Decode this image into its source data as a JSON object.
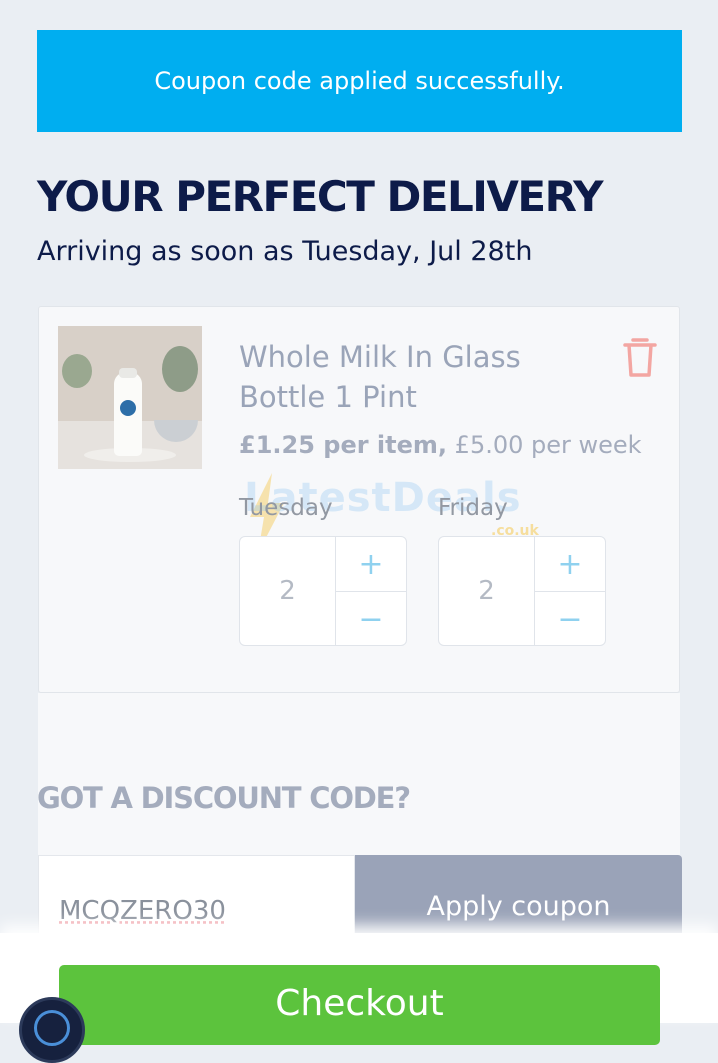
{
  "banner": {
    "message": "Coupon code applied successfully."
  },
  "colors": {
    "banner": "#00aef0",
    "heading": "#0d1b49",
    "checkout": "#5cc33d",
    "apply": "#9aa3b8"
  },
  "heading": {
    "title": "YOUR PERFECT DELIVERY",
    "subtitle": "Arriving as soon as Tuesday, Jul 28th"
  },
  "product": {
    "name": "Whole Milk In Glass Bottle 1 Pint",
    "price_per_item": "£1.25 per item,",
    "price_per_week": "£5.00 per week",
    "remove_icon": "trash-icon",
    "days": [
      {
        "label": "Tuesday",
        "quantity": "2",
        "plus": "+",
        "minus": "−"
      },
      {
        "label": "Friday",
        "quantity": "2",
        "plus": "+",
        "minus": "−"
      }
    ]
  },
  "watermark": {
    "text": "LatestDeals",
    "sub": ".co.uk"
  },
  "discount": {
    "title": "GOT A DISCOUNT CODE?",
    "code_value": "MCQZERO30",
    "apply_label": "Apply coupon"
  },
  "checkout": {
    "label": "Checkout"
  },
  "chat": {
    "icon": "chat-icon"
  }
}
